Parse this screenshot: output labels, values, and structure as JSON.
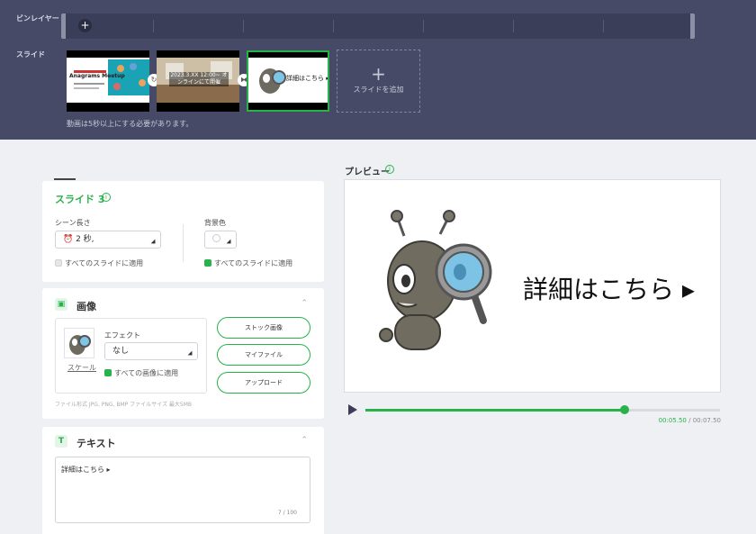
{
  "timeline": {
    "bgm_label": "ビンレイヤー",
    "slides_label": "スライド",
    "add_bgm": "+",
    "slides": [
      {
        "thumb_text": "Anagrams Meetup"
      },
      {
        "thumb_text": "2023.3.XX 12:00~ オンラインにて開催"
      },
      {
        "thumb_text": "詳細はこちら ▸"
      }
    ],
    "add_slide": {
      "plus": "+",
      "label": "スライドを追加"
    },
    "note": "動画は5秒以上にする必要があります。"
  },
  "slide_settings": {
    "title": "スライド 3",
    "info_icon": "info-icon",
    "scene_length_label": "シーン長さ",
    "scene_length_value": "2 秒,",
    "apply_all_length": "すべてのスライドに適用",
    "bg_color_label": "背景色",
    "apply_all_bg": "すべてのスライドに適用"
  },
  "image_section": {
    "title": "画像",
    "effect_label": "エフェクト",
    "effect_value": "なし",
    "scale_link": "スケール",
    "apply_all_images": "すべての画像に適用",
    "buttons": {
      "stock": "ストック画像",
      "my_files": "マイファイル",
      "upload": "アップロード"
    },
    "file_note": "ファイル形式 JPG, PNG, BMP ファイルサイズ 最大5MB"
  },
  "text_section": {
    "title": "テキスト",
    "value": "詳細はこちら ▸",
    "counter": "7 / 100"
  },
  "preview": {
    "label": "プレビュー",
    "slide_text": "詳細はこちら ▸",
    "progress": 0.73,
    "current_time": "00:05.50",
    "separator": " / ",
    "total_time": "00:07.50"
  },
  "colors": {
    "accent": "#27b24a",
    "top_bg": "#464a66"
  }
}
